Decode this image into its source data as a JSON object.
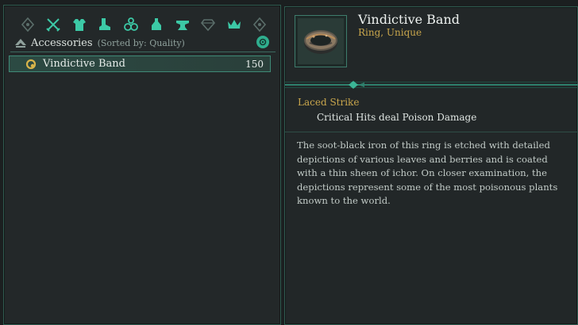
{
  "inventory": {
    "tabs": [
      {
        "icon": "shield-tab-icon"
      },
      {
        "icon": "crossed-swords-icon"
      },
      {
        "icon": "chest-armor-icon"
      },
      {
        "icon": "boots-icon"
      },
      {
        "icon": "ring-icon"
      },
      {
        "icon": "potion-icon"
      },
      {
        "icon": "anvil-icon"
      },
      {
        "icon": "gem-icon"
      },
      {
        "icon": "crown-icon"
      },
      {
        "icon": "shield-tab-icon"
      }
    ],
    "category_title": "Accessories",
    "sort_label": "(Sorted by: Quality)",
    "items": [
      {
        "name": "Vindictive Band",
        "value": "150",
        "icon": "ring-icon",
        "icon_color": "#d8b44a"
      }
    ]
  },
  "details": {
    "title": "Vindictive Band",
    "type": "Ring, Unique",
    "trait_name": "Laced Strike",
    "trait_description": "Critical Hits deal Poison Damage",
    "lore": "The soot-black iron of this ring is etched with detailed depictions of various leaves and berries and is coated with a thin sheen of ichor. On closer examination, the depictions represent some of the most poisonous plants known to the world."
  },
  "colors": {
    "accent": "#3cc9a6",
    "unique": "#c9a64c",
    "panel": "#232829",
    "border": "#2f5b50"
  }
}
